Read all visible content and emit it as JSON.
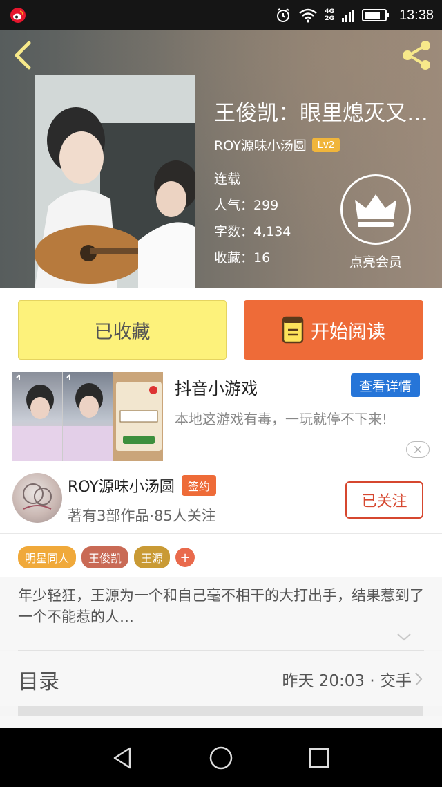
{
  "status_bar": {
    "time": "13:38",
    "network_top": "4G",
    "network_bottom": "2G"
  },
  "book": {
    "title": "王俊凯：眼里熄灭又…",
    "author": "ROY源味小汤圆",
    "level": "Lv2",
    "status": "连载",
    "popularity": "人气：299",
    "word_count": "字数：4,134",
    "favorites": "收藏：16",
    "vip_label": "点亮会员"
  },
  "actions": {
    "favorited_label": "已收藏",
    "read_label": "开始阅读"
  },
  "ad": {
    "title": "抖音小游戏",
    "detail_button": "查看详情",
    "description": "本地这游戏有毒，一玩就停不下来!"
  },
  "author_card": {
    "name": "ROY源味小汤圆",
    "badge": "签约",
    "meta": "著有3部作品·85人关注",
    "follow_label": "已关注"
  },
  "tags": [
    {
      "label": "明星同人",
      "color": "#f0a93a"
    },
    {
      "label": "王俊凯",
      "color": "#c96a55"
    },
    {
      "label": "王源",
      "color": "#c99a35"
    }
  ],
  "tag_add_label": "+",
  "synopsis": "年少轻狂，王源为一个和自己毫不相干的大打出手，结果惹到了一个不能惹的人…",
  "toc": {
    "title": "目录",
    "latest": "昨天 20:03 · 交手"
  },
  "colors": {
    "accent_orange": "#ee6b38",
    "favorite_yellow": "#fdf27b",
    "ad_blue": "#2675d8",
    "follow_red": "#d6472f",
    "level_gold": "#f0b53b"
  },
  "icons": [
    "weibo-icon",
    "alarm-icon",
    "wifi-icon",
    "signal-icon",
    "battery-icon",
    "back-arrow-icon",
    "share-icon",
    "crown-icon",
    "book-icon",
    "close-icon",
    "chevron-down-icon",
    "chevron-right-icon",
    "nav-back-icon",
    "nav-home-icon",
    "nav-recent-icon"
  ]
}
